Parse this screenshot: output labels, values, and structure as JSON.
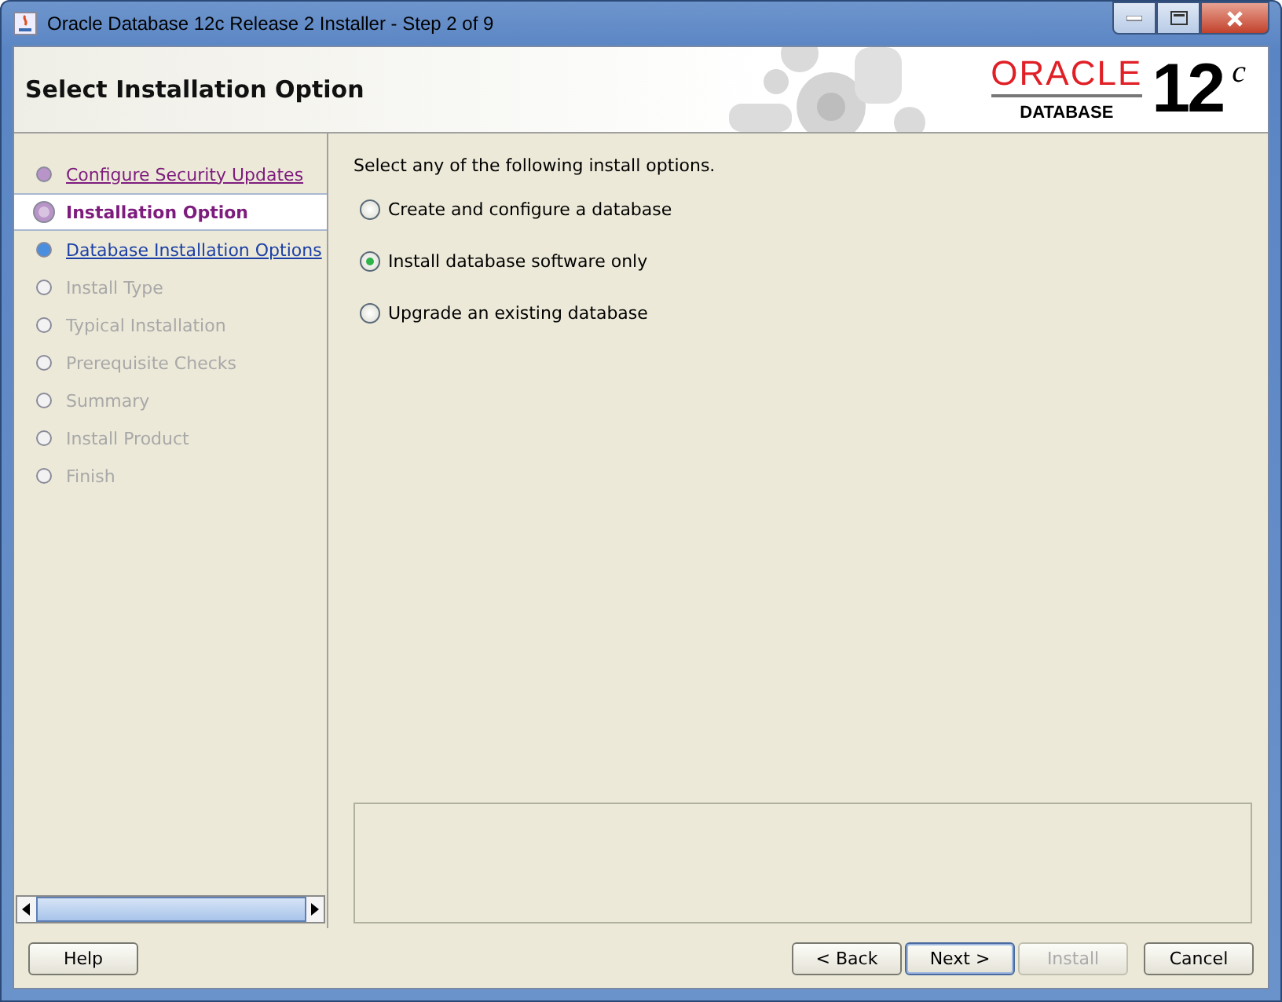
{
  "window": {
    "title": "Oracle Database 12c Release 2 Installer - Step 2 of 9"
  },
  "header": {
    "title": "Select Installation Option",
    "logo_brand": "ORACLE",
    "logo_product": "DATABASE",
    "logo_version": "12",
    "logo_suffix": "c"
  },
  "steps": [
    {
      "label": "Configure Security Updates",
      "kind": "done",
      "selected": false
    },
    {
      "label": "Installation Option",
      "kind": "current",
      "selected": true
    },
    {
      "label": "Database Installation Options",
      "kind": "next",
      "selected": false
    },
    {
      "label": "Install Type",
      "kind": "pending",
      "selected": false
    },
    {
      "label": "Typical Installation",
      "kind": "pending",
      "selected": false
    },
    {
      "label": "Prerequisite Checks",
      "kind": "pending",
      "selected": false
    },
    {
      "label": "Summary",
      "kind": "pending",
      "selected": false
    },
    {
      "label": "Install Product",
      "kind": "pending",
      "selected": false
    },
    {
      "label": "Finish",
      "kind": "pending",
      "selected": false
    }
  ],
  "prompt": "Select any of the following install options.",
  "options": [
    {
      "label": "Create and configure a database",
      "selected": false
    },
    {
      "label": "Install database software only",
      "selected": true
    },
    {
      "label": "Upgrade an existing database",
      "selected": false
    }
  ],
  "buttons": [
    {
      "label": "Help",
      "disabled": false,
      "default": false
    },
    {
      "label": "< Back",
      "disabled": false,
      "default": false
    },
    {
      "label": "Next >",
      "disabled": false,
      "default": true
    },
    {
      "label": "Install",
      "disabled": true,
      "default": false
    },
    {
      "label": "Cancel",
      "disabled": false,
      "default": false
    }
  ]
}
